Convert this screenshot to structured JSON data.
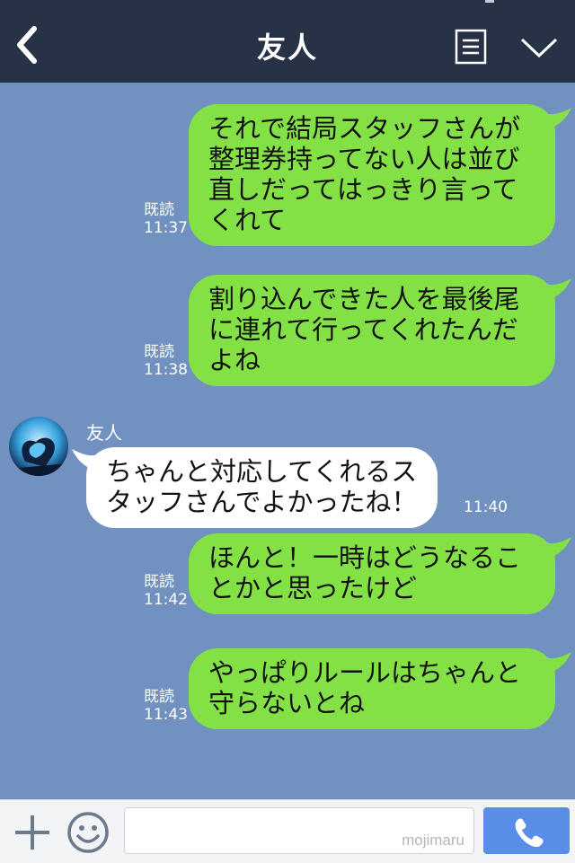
{
  "header": {
    "title": "友人",
    "back_icon": "chevron-left-icon",
    "menu_icon": "notes-icon",
    "expand_icon": "chevron-down-icon"
  },
  "colors": {
    "background": "#7191c1",
    "header": "#273246",
    "outgoing_bubble": "#84e145",
    "incoming_bubble": "#ffffff",
    "call_button": "#5a8de8"
  },
  "messages": [
    {
      "direction": "outgoing",
      "lines": [
        "それで結局スタッフさんが",
        "整理券持ってない人は並び",
        "直しだってはっきり言って",
        "くれて"
      ],
      "read": "既読",
      "time": "11:37"
    },
    {
      "direction": "outgoing",
      "lines": [
        "割り込んできた人を最後尾",
        "に連れて行ってくれたんだ",
        "よね"
      ],
      "read": "既読",
      "time": "11:38"
    },
    {
      "direction": "incoming",
      "sender": "友人",
      "lines": [
        "ちゃんと対応してくれるス",
        "タッフさんでよかったね！"
      ],
      "time": "11:40"
    },
    {
      "direction": "outgoing",
      "lines": [
        "ほんと！一時はどうなるこ",
        "とかと思ったけど"
      ],
      "read": "既読",
      "time": "11:42"
    },
    {
      "direction": "outgoing",
      "lines": [
        "やっぱりルールはちゃんと",
        "守らないとね"
      ],
      "read": "既読",
      "time": "11:43"
    }
  ],
  "input_bar": {
    "input_value": "",
    "watermark": "mojimaru",
    "plus_icon": "plus-icon",
    "emoji_icon": "smiley-icon",
    "call_icon": "phone-icon"
  }
}
